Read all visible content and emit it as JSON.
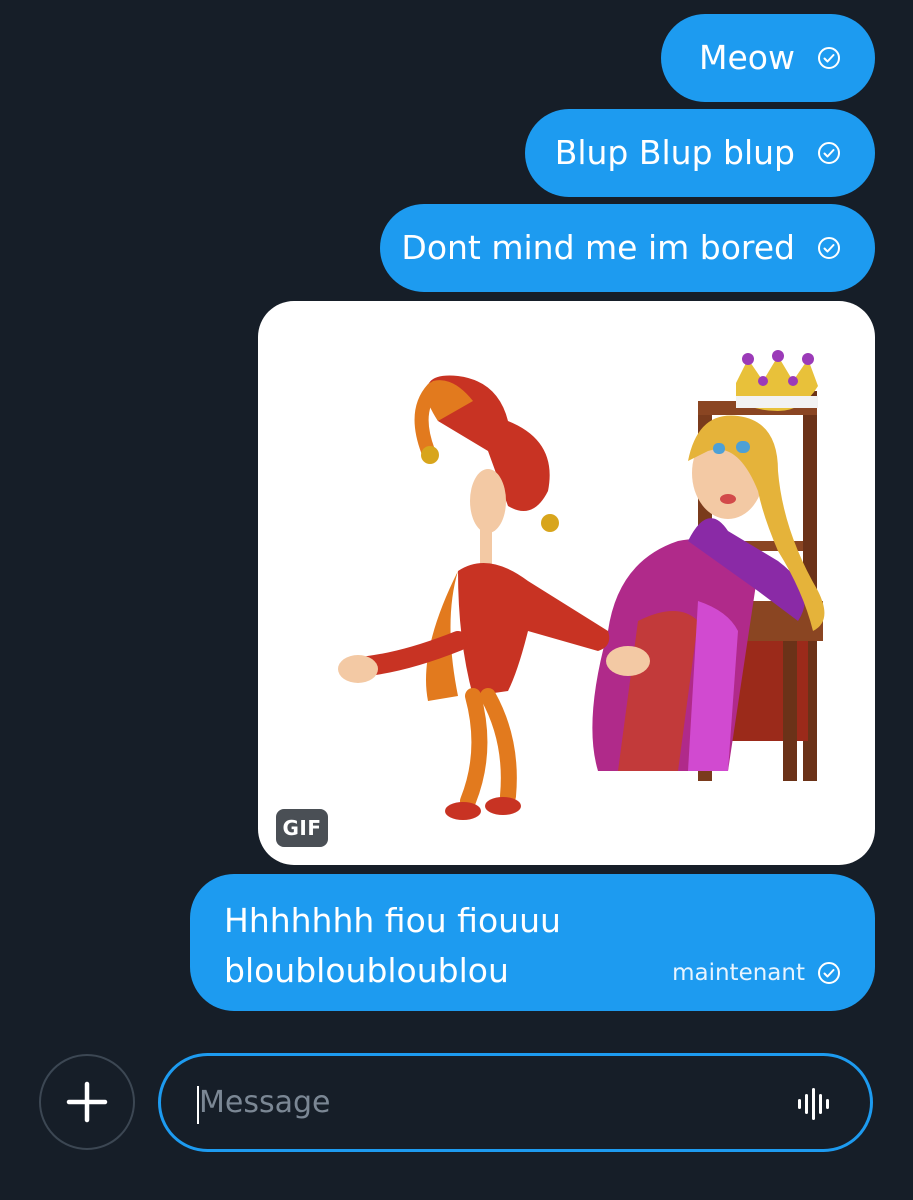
{
  "messages": [
    {
      "text": "Meow",
      "status_icon": "check-circle-icon"
    },
    {
      "text": "Blup Blup blup",
      "status_icon": "check-circle-icon"
    },
    {
      "text": "Dont mind me im bored",
      "status_icon": "check-circle-icon"
    }
  ],
  "gif": {
    "badge": "GIF",
    "scene": "animated-jester-and-queen"
  },
  "last_message": {
    "line1": "Hhhhhhh fiou fiouuu",
    "line2": "bloubloubloublou",
    "timestamp": "maintenant",
    "status_icon": "check-circle-icon"
  },
  "composer": {
    "placeholder": "Message",
    "value": "",
    "add_icon": "plus-icon",
    "voice_icon": "audio-waveform-icon"
  },
  "colors": {
    "background": "#161e28",
    "bubble": "#1d9bf0",
    "accent": "#1d9bf0"
  }
}
